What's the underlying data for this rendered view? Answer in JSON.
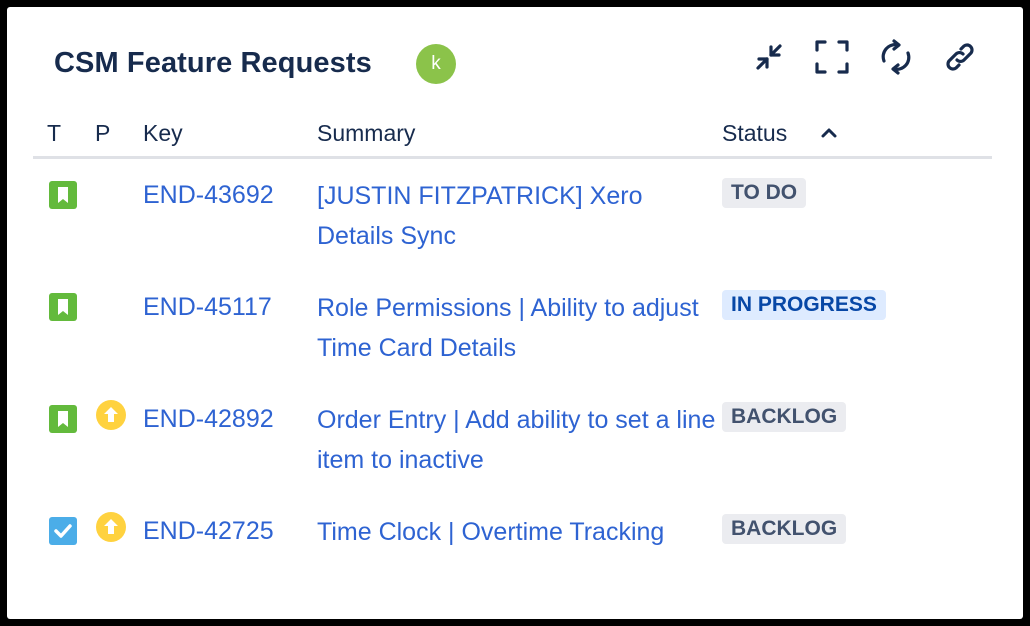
{
  "header": {
    "title": "CSM Feature Requests",
    "avatar_initial": "k",
    "icons": [
      "collapse-icon",
      "fullscreen-icon",
      "refresh-icon",
      "link-icon"
    ]
  },
  "columns": {
    "type": "T",
    "priority": "P",
    "key": "Key",
    "summary": "Summary",
    "status": "Status",
    "status_sort": "ascending"
  },
  "rows": [
    {
      "type": "story",
      "priority": "",
      "key": "END-43692",
      "summary": "[JUSTIN FITZPATRICK] Xero Details Sync",
      "status": "TO DO",
      "status_style": "grey"
    },
    {
      "type": "story",
      "priority": "",
      "key": "END-45117",
      "summary": "Role Permissions | Ability to adjust Time Card Details",
      "status": "IN PROGRESS",
      "status_style": "blue"
    },
    {
      "type": "story",
      "priority": "high",
      "key": "END-42892",
      "summary": "Order Entry | Add ability to set a line item to inactive",
      "status": "BACKLOG",
      "status_style": "grey"
    },
    {
      "type": "task",
      "priority": "high",
      "key": "END-42725",
      "summary": "Time Clock | Overtime Tracking",
      "status": "BACKLOG",
      "status_style": "grey"
    }
  ],
  "colors": {
    "link": "#2e63d2",
    "heading": "#172b4d",
    "story": "#63ba3c",
    "task": "#4bade8",
    "priority_high": "#ffd23f",
    "avatar": "#8bc34a"
  }
}
